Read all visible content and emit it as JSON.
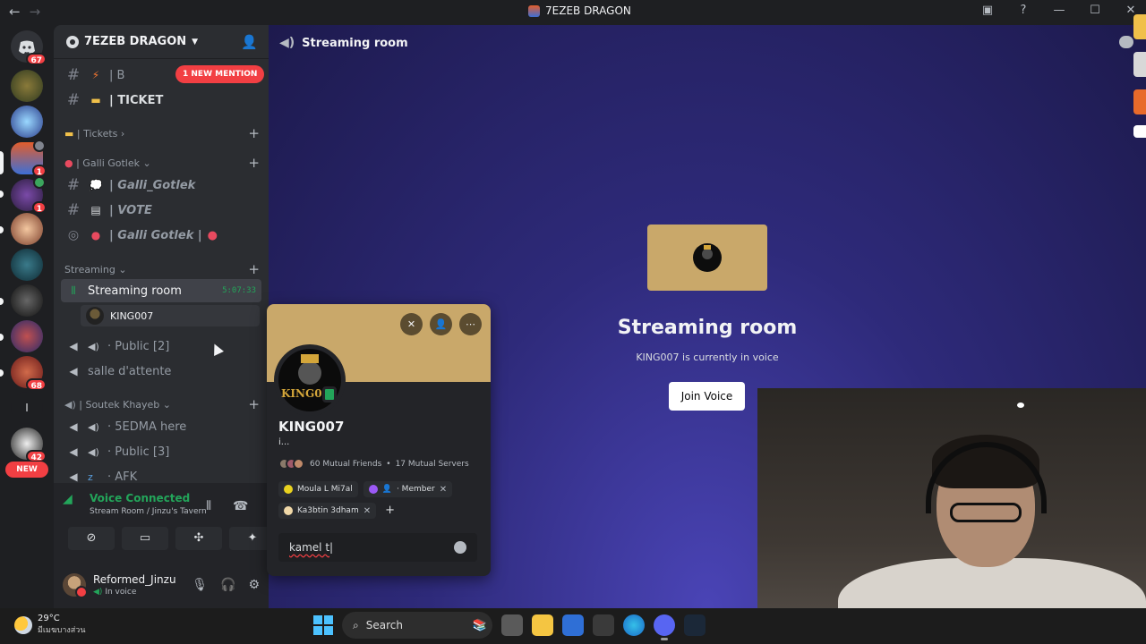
{
  "titlebar": {
    "title": "7EZEB DRAGON",
    "back_icon": "←",
    "forward_icon": "→",
    "inbox_icon": "inbox-icon",
    "help_icon": "?",
    "minimize": "—",
    "maximize": "☐",
    "close": "✕"
  },
  "rail": {
    "home_badge": "67",
    "badges": [
      "1",
      "1",
      "68",
      "42"
    ],
    "new_label": "NEW",
    "divider_label": "I"
  },
  "sidebar": {
    "guild_name": "7EZEB DRAGON",
    "mention_label": "1 NEW MENTION",
    "channels": {
      "b_partial": "B",
      "ticket": "| TICKET",
      "galli_gotlek": "| Galli_Gotlek",
      "vote": "| VOTE",
      "galli_stage": "| Galli Gotlek |",
      "streaming_room": "Streaming room",
      "streaming_timer": "5:07:33",
      "king_user": "KING007",
      "public2": "· Public [2]",
      "salle": "salle d'attente",
      "edma": "· 5EDMA here",
      "public3": "· Public [3]",
      "afk": "· AFK"
    },
    "categories": {
      "tickets": "| Tickets",
      "galli": "| Galli Gotlek",
      "streaming": "Streaming",
      "soutek": "| Soutek Khayeb"
    }
  },
  "voice_panel": {
    "title": "Voice Connected",
    "subtitle": "Stream Room / Jinzu's Tavern"
  },
  "user_bar": {
    "username": "Reformed_Jinzu",
    "status": "In voice"
  },
  "main": {
    "header_title": "Streaming room",
    "card_title": "Streaming room",
    "card_subtitle": "KING007 is currently in voice",
    "join_label": "Join Voice",
    "stream_card_label": "KING007"
  },
  "popout": {
    "name": "KING007",
    "status": "i...",
    "avatar_text": "KING0",
    "mutual_friends": "60 Mutual Friends",
    "mutual_sep": "•",
    "mutual_servers": "17 Mutual Servers",
    "roles": [
      {
        "name": "Moula L Mi7al",
        "color": "#e9d21f",
        "removable": false
      },
      {
        "name": "· Member",
        "color": "#9b59f5",
        "removable": true
      },
      {
        "name": "Ka3btin 3dham",
        "color": "#f0d8a8",
        "removable": true
      }
    ],
    "add_role": "+",
    "note_value": "kamel t"
  },
  "taskbar": {
    "temperature": "29°C",
    "weather_text": "มีเมฆบางส่วน",
    "search_label": "Search"
  },
  "colors": {
    "accent_green": "#23a55a",
    "mention_red": "#f23f43",
    "banner_gold": "#c9a86a"
  }
}
